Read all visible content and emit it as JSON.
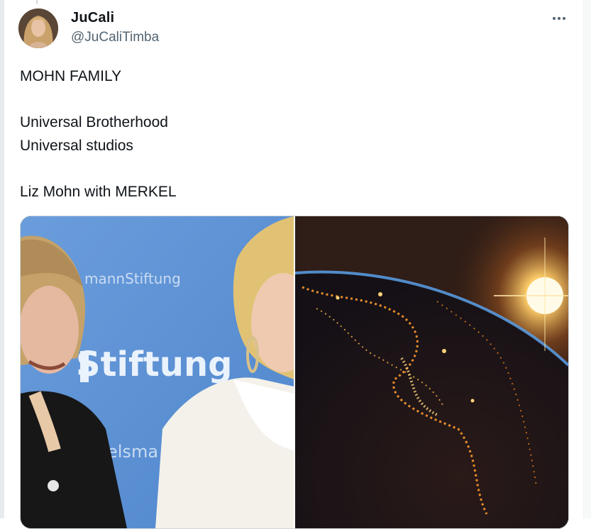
{
  "author": {
    "name": "JuCali",
    "handle": "@JuCaliTimba"
  },
  "tweet": {
    "lines": [
      "MOHN FAMILY",
      "Universal Brotherhood",
      "Universal studios",
      "Liz Mohn with MERKEL"
    ]
  },
  "media": {
    "left_photo": {
      "backdrop_text_top": "mannStiftung",
      "backdrop_text_main": "Stiftung",
      "backdrop_text_bottom": "elsma"
    },
    "right_photo": {}
  },
  "icons": {
    "more": "more-horizontal-icon"
  },
  "colors": {
    "text": "#0f1419",
    "secondary_text": "#536471",
    "border": "#cfd9de",
    "backdrop_blue": "#5f93d6"
  }
}
